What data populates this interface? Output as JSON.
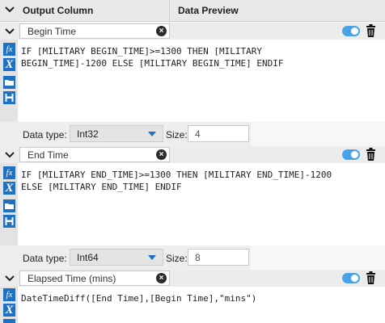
{
  "header": {
    "col_output": "Output Column",
    "col_preview": "Data Preview"
  },
  "sections": [
    {
      "name": "Begin Time",
      "expression": [
        "IF [MILITARY BEGIN_TIME]>=1300 THEN [MILITARY",
        "BEGIN_TIME]-1200 ELSE [MILITARY BEGIN_TIME] ENDIF"
      ],
      "data_type_label": "Data type:",
      "data_type": "Int32",
      "size_label": "Size:",
      "size": "4",
      "enabled": true
    },
    {
      "name": "End Time",
      "expression": [
        "IF [MILITARY END_TIME]>=1300 THEN [MILITARY END_TIME]-1200",
        "ELSE [MILITARY END_TIME] ENDIF"
      ],
      "data_type_label": "Data type:",
      "data_type": "Int64",
      "size_label": "Size:",
      "size": "8",
      "enabled": true
    },
    {
      "name": "Elapsed Time (mins)",
      "expression": [
        "DateTimeDiff([End Time],[Begin Time],\"mins\")"
      ],
      "enabled": true
    }
  ],
  "icons": {
    "collapse": "chevron-down-icon",
    "clear": "clear-x-icon",
    "toggle": "toggle-switch",
    "delete": "trash-icon",
    "functions": "fx-icon",
    "variables": "x-variable-icon",
    "open": "folder-open-icon",
    "save": "save-icon"
  },
  "colors": {
    "accent": "#1f6fc3",
    "toggle_on": "#4aa3e6"
  }
}
